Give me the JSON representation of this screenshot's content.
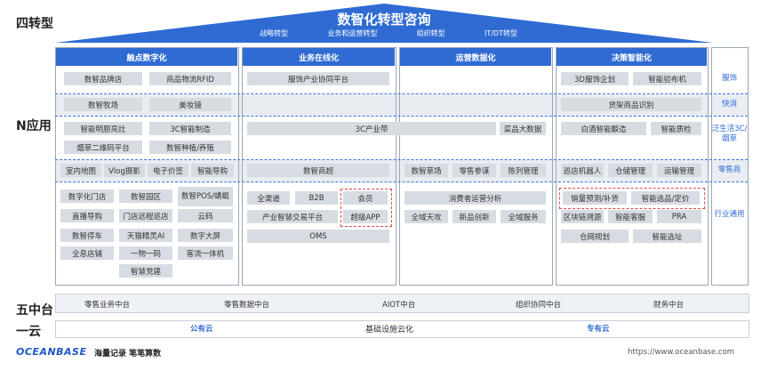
{
  "roof": {
    "title": "数智化转型咨询",
    "subtitles": [
      "战略转型",
      "业务和运营转型",
      "组织转型",
      "IT/DT转型"
    ],
    "color": "#2f6bd3"
  },
  "row_labels": {
    "four": "四转型",
    "n": "N应用",
    "five": "五中台",
    "one": "一云"
  },
  "columns": [
    {
      "title": "触点数字化"
    },
    {
      "title": "业务在线化"
    },
    {
      "title": "运营数据化"
    },
    {
      "title": "决策智能化"
    }
  ],
  "col1": {
    "r1": [
      "数智品牌店",
      "商品物流RFID"
    ],
    "r2": [
      "数智牧场",
      "美妆镜"
    ],
    "r3": [
      "智能明厨亮灶",
      "3C智能制造",
      "烟草二维码平台",
      "数智种植/养殖"
    ],
    "r4": [
      "室内地图",
      "Vlog摄影",
      "电子价签",
      "智能导购"
    ],
    "r5": [
      "数字化门店",
      "数智园区",
      "数智POS/蜻蜓",
      "直播导购",
      "门店远程巡店",
      "云码",
      "数智停车",
      "天猫精灵AI",
      "数字大屏",
      "全息店铺",
      "一物一码",
      "客流一体机",
      "智慧党建"
    ]
  },
  "col2": {
    "r1": "服饰产业协同平台",
    "r3": "3C产业带",
    "r4": "数智商超",
    "r5": [
      "全渠道",
      "B2B",
      "会员",
      "产业智慧交易平台",
      "超级APP",
      "OMS"
    ]
  },
  "col3": {
    "r3": "菜品大数据",
    "r4": [
      "数智草场",
      "零售参谋",
      "陈列管理"
    ],
    "r5": [
      "消费者运营分析",
      "全域天攻",
      "新品创新",
      "全域服务"
    ]
  },
  "col4": {
    "r1": [
      "3D服饰企划",
      "智能验布机"
    ],
    "r2": "货架商品识别",
    "r3": [
      "白酒智能酿造",
      "智能质检"
    ],
    "r4": [
      "巡店机器人",
      "仓储管理",
      "运输管理"
    ],
    "r5": [
      "销量预测/补货",
      "智能选品/定价",
      "区块链溯源",
      "智能客服",
      "PRA",
      "仓网规划",
      "智能选址"
    ]
  },
  "side": [
    "服饰",
    "快消",
    "泛生活3C/烟草",
    "零售商",
    "行业通用"
  ],
  "middle": [
    "零售业务中台",
    "零售数据中台",
    "AIOT中台",
    "组织协同中台",
    "财务中台"
  ],
  "cloud": {
    "public": "公有云",
    "base": "基础设施云化",
    "private": "专有云"
  },
  "footer": {
    "logo": "OCEANBASE",
    "slogan": "海量记录 笔笔算数",
    "url": "https://www.oceanbase.com"
  },
  "colors": {
    "accent": "#2f6bd3",
    "box": "#d7dce3",
    "band": "#e9edf2",
    "highlight": "#e04646"
  }
}
